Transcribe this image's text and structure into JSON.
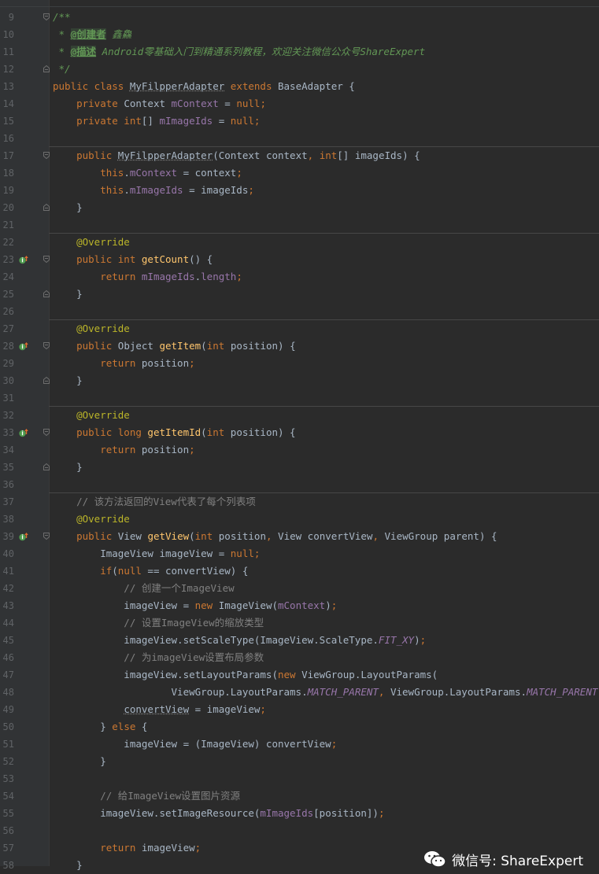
{
  "watermark": {
    "text": "微信号: ShareExpert"
  },
  "lines": [
    {
      "n": "9",
      "fold": "open",
      "tokens": [
        {
          "t": "/**",
          "c": "doc"
        }
      ]
    },
    {
      "n": "10",
      "tokens": [
        {
          "t": " * ",
          "c": "doc"
        },
        {
          "t": "@创建者",
          "c": "tag"
        },
        {
          "t": " 鑫鱻",
          "c": "doc"
        }
      ]
    },
    {
      "n": "11",
      "tokens": [
        {
          "t": " * ",
          "c": "doc"
        },
        {
          "t": "@描述",
          "c": "tag"
        },
        {
          "t": " Android零基础入门到精通系列教程，欢迎关注微信公众号ShareExpert",
          "c": "doc"
        }
      ]
    },
    {
      "n": "12",
      "fold": "close",
      "tokens": [
        {
          "t": " */",
          "c": "doc"
        }
      ]
    },
    {
      "n": "13",
      "tokens": [
        {
          "t": "public class ",
          "c": "kw"
        },
        {
          "t": "MyFilpperAdapter",
          "c": "unused"
        },
        {
          "t": " extends ",
          "c": "kw"
        },
        {
          "t": "BaseAdapter {",
          "c": ""
        }
      ]
    },
    {
      "n": "14",
      "tokens": [
        {
          "t": "    private ",
          "c": "kw"
        },
        {
          "t": "Context ",
          "c": ""
        },
        {
          "t": "mContext",
          "c": "fld"
        },
        {
          "t": " = ",
          "c": ""
        },
        {
          "t": "null",
          "c": "kw"
        },
        {
          "t": ";",
          "c": "kw"
        }
      ]
    },
    {
      "n": "15",
      "tokens": [
        {
          "t": "    private int",
          "c": "kw"
        },
        {
          "t": "[] ",
          "c": ""
        },
        {
          "t": "mImageIds",
          "c": "fld"
        },
        {
          "t": " = ",
          "c": ""
        },
        {
          "t": "null",
          "c": "kw"
        },
        {
          "t": ";",
          "c": "kw"
        }
      ]
    },
    {
      "n": "16",
      "sep": true,
      "tokens": []
    },
    {
      "n": "17",
      "fold": "open",
      "tokens": [
        {
          "t": "    public ",
          "c": "kw"
        },
        {
          "t": "MyFilpperAdapter",
          "c": "unused"
        },
        {
          "t": "(Context context",
          "c": ""
        },
        {
          "t": ", ",
          "c": "kw"
        },
        {
          "t": "int",
          "c": "kw"
        },
        {
          "t": "[] imageIds) {",
          "c": ""
        }
      ]
    },
    {
      "n": "18",
      "tokens": [
        {
          "t": "        this",
          "c": "kw"
        },
        {
          "t": ".",
          "c": ""
        },
        {
          "t": "mContext",
          "c": "fld"
        },
        {
          "t": " = context",
          "c": ""
        },
        {
          "t": ";",
          "c": "kw"
        }
      ]
    },
    {
      "n": "19",
      "tokens": [
        {
          "t": "        this",
          "c": "kw"
        },
        {
          "t": ".",
          "c": ""
        },
        {
          "t": "mImageIds",
          "c": "fld"
        },
        {
          "t": " = imageIds",
          "c": ""
        },
        {
          "t": ";",
          "c": "kw"
        }
      ]
    },
    {
      "n": "20",
      "fold": "close",
      "tokens": [
        {
          "t": "    }",
          "c": ""
        }
      ]
    },
    {
      "n": "21",
      "sep": true,
      "tokens": []
    },
    {
      "n": "22",
      "tokens": [
        {
          "t": "    @Override",
          "c": "ann"
        }
      ]
    },
    {
      "n": "23",
      "marker": true,
      "fold": "open",
      "tokens": [
        {
          "t": "    public int ",
          "c": "kw"
        },
        {
          "t": "getCount",
          "c": "fn"
        },
        {
          "t": "() {",
          "c": ""
        }
      ]
    },
    {
      "n": "24",
      "tokens": [
        {
          "t": "        return ",
          "c": "kw"
        },
        {
          "t": "mImageIds",
          "c": "fld"
        },
        {
          "t": ".",
          "c": ""
        },
        {
          "t": "length",
          "c": "fld"
        },
        {
          "t": ";",
          "c": "kw"
        }
      ]
    },
    {
      "n": "25",
      "fold": "close",
      "tokens": [
        {
          "t": "    }",
          "c": ""
        }
      ]
    },
    {
      "n": "26",
      "sep": true,
      "tokens": []
    },
    {
      "n": "27",
      "tokens": [
        {
          "t": "    @Override",
          "c": "ann"
        }
      ]
    },
    {
      "n": "28",
      "marker": true,
      "fold": "open",
      "tokens": [
        {
          "t": "    public ",
          "c": "kw"
        },
        {
          "t": "Object ",
          "c": ""
        },
        {
          "t": "getItem",
          "c": "fn"
        },
        {
          "t": "(",
          "c": ""
        },
        {
          "t": "int ",
          "c": "kw"
        },
        {
          "t": "position) {",
          "c": ""
        }
      ]
    },
    {
      "n": "29",
      "tokens": [
        {
          "t": "        return ",
          "c": "kw"
        },
        {
          "t": "position",
          "c": ""
        },
        {
          "t": ";",
          "c": "kw"
        }
      ]
    },
    {
      "n": "30",
      "fold": "close",
      "tokens": [
        {
          "t": "    }",
          "c": ""
        }
      ]
    },
    {
      "n": "31",
      "sep": true,
      "tokens": []
    },
    {
      "n": "32",
      "tokens": [
        {
          "t": "    @Override",
          "c": "ann"
        }
      ]
    },
    {
      "n": "33",
      "marker": true,
      "fold": "open",
      "tokens": [
        {
          "t": "    public long ",
          "c": "kw"
        },
        {
          "t": "getItemId",
          "c": "fn"
        },
        {
          "t": "(",
          "c": ""
        },
        {
          "t": "int ",
          "c": "kw"
        },
        {
          "t": "position) {",
          "c": ""
        }
      ]
    },
    {
      "n": "34",
      "tokens": [
        {
          "t": "        return ",
          "c": "kw"
        },
        {
          "t": "position",
          "c": ""
        },
        {
          "t": ";",
          "c": "kw"
        }
      ]
    },
    {
      "n": "35",
      "fold": "close",
      "tokens": [
        {
          "t": "    }",
          "c": ""
        }
      ]
    },
    {
      "n": "36",
      "sep": true,
      "tokens": []
    },
    {
      "n": "37",
      "tokens": [
        {
          "t": "    // 该方法返回的View代表了每个列表项",
          "c": "cmt"
        }
      ]
    },
    {
      "n": "38",
      "tokens": [
        {
          "t": "    @Override",
          "c": "ann"
        }
      ]
    },
    {
      "n": "39",
      "marker": true,
      "fold": "open",
      "tokens": [
        {
          "t": "    public ",
          "c": "kw"
        },
        {
          "t": "View ",
          "c": ""
        },
        {
          "t": "getView",
          "c": "fn"
        },
        {
          "t": "(",
          "c": ""
        },
        {
          "t": "int ",
          "c": "kw"
        },
        {
          "t": "position",
          "c": ""
        },
        {
          "t": ", ",
          "c": "kw"
        },
        {
          "t": "View convertView",
          "c": ""
        },
        {
          "t": ", ",
          "c": "kw"
        },
        {
          "t": "ViewGroup parent) {",
          "c": ""
        }
      ]
    },
    {
      "n": "40",
      "tokens": [
        {
          "t": "        ImageView imageView = ",
          "c": ""
        },
        {
          "t": "null",
          "c": "kw"
        },
        {
          "t": ";",
          "c": "kw"
        }
      ]
    },
    {
      "n": "41",
      "tokens": [
        {
          "t": "        if",
          "c": "kw"
        },
        {
          "t": "(",
          "c": ""
        },
        {
          "t": "null",
          "c": "kw"
        },
        {
          "t": " == convertView) {",
          "c": ""
        }
      ]
    },
    {
      "n": "42",
      "tokens": [
        {
          "t": "            // 创建一个ImageView",
          "c": "cmt"
        }
      ]
    },
    {
      "n": "43",
      "tokens": [
        {
          "t": "            imageView = ",
          "c": ""
        },
        {
          "t": "new ",
          "c": "kw"
        },
        {
          "t": "ImageView(",
          "c": ""
        },
        {
          "t": "mContext",
          "c": "fld"
        },
        {
          "t": ")",
          "c": ""
        },
        {
          "t": ";",
          "c": "kw"
        }
      ]
    },
    {
      "n": "44",
      "tokens": [
        {
          "t": "            // 设置ImageView的缩放类型",
          "c": "cmt"
        }
      ]
    },
    {
      "n": "45",
      "tokens": [
        {
          "t": "            imageView.setScaleType(ImageView.ScaleType.",
          "c": ""
        },
        {
          "t": "FIT_XY",
          "c": "stc"
        },
        {
          "t": ")",
          "c": ""
        },
        {
          "t": ";",
          "c": "kw"
        }
      ]
    },
    {
      "n": "46",
      "tokens": [
        {
          "t": "            // 为imageView设置布局参数",
          "c": "cmt"
        }
      ]
    },
    {
      "n": "47",
      "tokens": [
        {
          "t": "            imageView.setLayoutParams(",
          "c": ""
        },
        {
          "t": "new ",
          "c": "kw"
        },
        {
          "t": "ViewGroup.LayoutParams(",
          "c": ""
        }
      ]
    },
    {
      "n": "48",
      "tokens": [
        {
          "t": "                    ViewGroup.LayoutParams.",
          "c": ""
        },
        {
          "t": "MATCH_PARENT",
          "c": "stc"
        },
        {
          "t": ", ",
          "c": "kw"
        },
        {
          "t": "ViewGroup.LayoutParams.",
          "c": ""
        },
        {
          "t": "MATCH_PARENT",
          "c": "stc"
        },
        {
          "t": "))",
          "c": ""
        },
        {
          "t": ";",
          "c": "kw"
        }
      ]
    },
    {
      "n": "49",
      "tokens": [
        {
          "t": "            ",
          "c": ""
        },
        {
          "t": "convertView",
          "c": "unused"
        },
        {
          "t": " = imageView",
          "c": ""
        },
        {
          "t": ";",
          "c": "kw"
        }
      ]
    },
    {
      "n": "50",
      "tokens": [
        {
          "t": "        } ",
          "c": ""
        },
        {
          "t": "else ",
          "c": "kw"
        },
        {
          "t": "{",
          "c": ""
        }
      ]
    },
    {
      "n": "51",
      "tokens": [
        {
          "t": "            imageView = (ImageView) convertView",
          "c": ""
        },
        {
          "t": ";",
          "c": "kw"
        }
      ]
    },
    {
      "n": "52",
      "tokens": [
        {
          "t": "        }",
          "c": ""
        }
      ]
    },
    {
      "n": "53",
      "tokens": []
    },
    {
      "n": "54",
      "tokens": [
        {
          "t": "        // 给ImageView设置图片资源",
          "c": "cmt"
        }
      ]
    },
    {
      "n": "55",
      "tokens": [
        {
          "t": "        imageView.setImageResource(",
          "c": ""
        },
        {
          "t": "mImageIds",
          "c": "fld"
        },
        {
          "t": "[position])",
          "c": ""
        },
        {
          "t": ";",
          "c": "kw"
        }
      ]
    },
    {
      "n": "56",
      "tokens": []
    },
    {
      "n": "57",
      "tokens": [
        {
          "t": "        return ",
          "c": "kw"
        },
        {
          "t": "imageView",
          "c": ""
        },
        {
          "t": ";",
          "c": "kw"
        }
      ]
    },
    {
      "n": "58",
      "tokens": [
        {
          "t": "    }",
          "c": ""
        }
      ]
    }
  ]
}
